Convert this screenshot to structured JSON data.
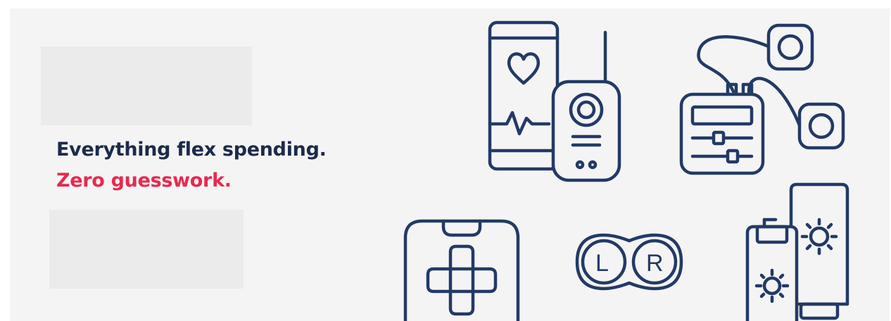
{
  "hero": {
    "headline": "Everything flex spending.",
    "subheadline": "Zero guesswork.",
    "headline_color": "#1c2b4a",
    "subheadline_color": "#e8294e",
    "icon_color": "#233a66"
  },
  "icons": {
    "contact_lens_case": {
      "left_label": "L",
      "right_label": "R"
    }
  }
}
